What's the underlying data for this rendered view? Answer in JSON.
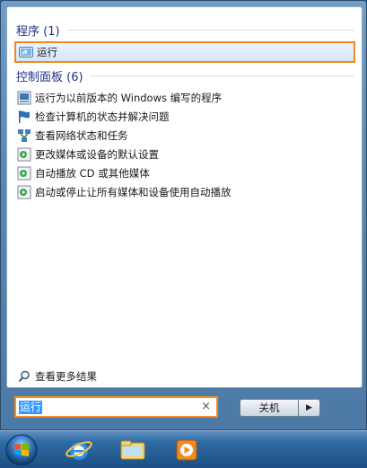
{
  "programs": {
    "header": "程序 (1)",
    "items": [
      {
        "label": "运行",
        "icon": "run-icon"
      }
    ]
  },
  "control_panel": {
    "header": "控制面板 (6)",
    "items": [
      {
        "label": "运行为以前版本的 Windows 编写的程序",
        "icon": "compat-icon"
      },
      {
        "label": "检查计算机的状态并解决问题",
        "icon": "flag-icon"
      },
      {
        "label": "查看网络状态和任务",
        "icon": "network-icon"
      },
      {
        "label": "更改媒体或设备的默认设置",
        "icon": "autoplay-icon"
      },
      {
        "label": "自动播放 CD 或其他媒体",
        "icon": "autoplay-icon"
      },
      {
        "label": "启动或停止让所有媒体和设备使用自动播放",
        "icon": "autoplay-icon"
      }
    ]
  },
  "see_more": "查看更多结果",
  "search": {
    "value": "运行",
    "clear": "×"
  },
  "shutdown": {
    "label": "关机",
    "arrow": "▶"
  },
  "colors": {
    "highlight_border": "#f08a23",
    "selection": "#3399ff",
    "header_text": "#1e3287"
  }
}
